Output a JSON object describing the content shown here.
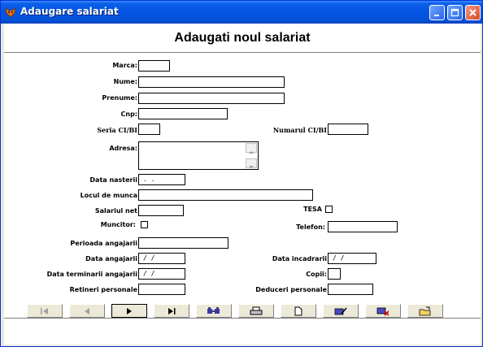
{
  "window": {
    "title": "Adaugare salariat"
  },
  "form": {
    "heading": "Adaugati noul salariat",
    "labels": {
      "marca": "Marca:",
      "nume": "Nume:",
      "prenume": "Prenume:",
      "cnp": "Cnp:",
      "seria": "Seria CI/BI",
      "numarul": "Numarul CI/BI",
      "adresa": "Adresa:",
      "data_nasterii": "Data nasterii",
      "locul_de_munca": "Locul de munca",
      "salariul_net": "Salariul net",
      "tesa": "TESA",
      "muncitor": "Muncitor:",
      "telefon": "Telefon:",
      "perioada_angajarii": "Perioada angajarii",
      "data_angajarii": "Data angajarii",
      "data_incadrarii": "Data incadrarii",
      "data_terminarii": "Data terminarii angajarii",
      "copii": "Copii:",
      "retineri": "Retineri personale",
      "deduceri": "Deduceri personale"
    },
    "values": {
      "data_nasterii": ". .",
      "data_angajarii": "/ /",
      "data_incadrarii": "/ /",
      "data_terminarii": "/ /"
    }
  },
  "toolbar": {
    "buttons": [
      "first-record-icon",
      "previous-record-icon",
      "next-record-icon",
      "last-record-icon",
      "find-icon",
      "print-icon",
      "new-record-icon",
      "edit-icon",
      "delete-icon",
      "exit-icon"
    ]
  },
  "colors": {
    "titlebar": "#0554e3",
    "window_bg": "#ece9d8",
    "close_button": "#d9492a"
  }
}
